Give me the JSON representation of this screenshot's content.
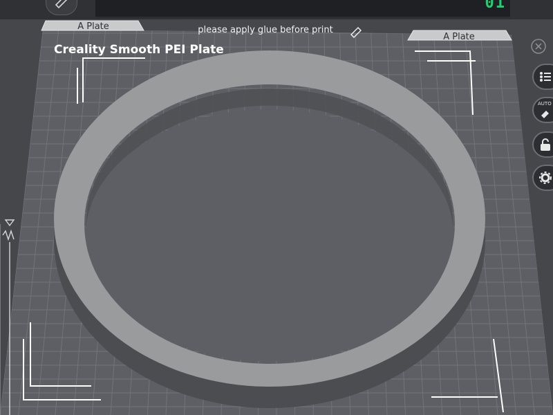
{
  "plate": {
    "name": "Creality Smooth PEI Plate",
    "glue_note": "please apply glue before print",
    "tab_left": "A Plate",
    "tab_right": "A Plate"
  },
  "top": {
    "plate_counter": "01"
  },
  "toolbar": {
    "auto_label": "AUTO"
  },
  "colors": {
    "background": "#45474b",
    "plate": "#5d5f64",
    "grid": "#707278",
    "object_top": "#9a9b9d",
    "object_side": "#4c4d50",
    "counter": "#1fd071"
  },
  "icons": [
    "pencil-icon",
    "edit-icon",
    "close-icon",
    "list-icon",
    "auto-arrange-icon",
    "lock-icon",
    "gear-icon",
    "z-height-icon"
  ]
}
